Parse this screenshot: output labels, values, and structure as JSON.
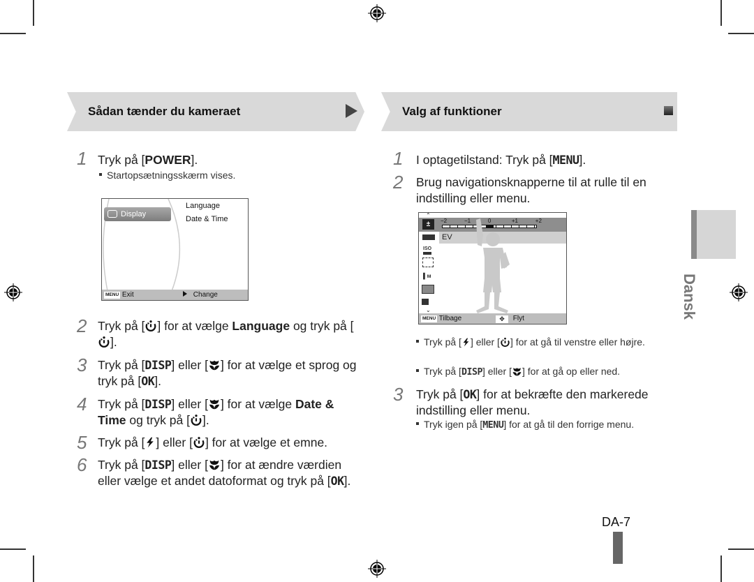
{
  "page": {
    "page_number": "DA-7",
    "language_tab": "Dansk"
  },
  "left_section": {
    "title": "Sådan tænder du kameraet",
    "steps": [
      {
        "num": "1",
        "parts": [
          "Tryk på [",
          "POWER",
          "]."
        ]
      },
      {
        "num": "2",
        "parts": [
          "Tryk på [",
          "timer-icon",
          "] for at vælge ",
          "Language",
          " og tryk på [",
          "timer-icon",
          "]."
        ]
      },
      {
        "num": "3",
        "parts": [
          "Tryk på [",
          "DISP",
          "] eller [",
          "macro-icon",
          "] for at vælge et sprog og tryk på [",
          "OK",
          "]."
        ]
      },
      {
        "num": "4",
        "parts": [
          "Tryk på [",
          "DISP",
          "] eller [",
          "macro-icon",
          "] for at vælge ",
          "Date & Time",
          " og tryk på [",
          "timer-icon",
          "]."
        ]
      },
      {
        "num": "5",
        "parts": [
          "Tryk på [",
          "flash-icon",
          "] eller [",
          "timer-icon",
          "] for at vælge et emne."
        ]
      },
      {
        "num": "6",
        "parts": [
          "Tryk på [",
          "DISP",
          "] eller [",
          "macro-icon",
          "] for at ændre værdien eller vælge et andet datoformat og tryk på [",
          "OK",
          "]."
        ]
      }
    ],
    "step1_sub": "Startopsætningsskærm vises.",
    "screen": {
      "menu_item": "Display",
      "options": [
        "Language",
        "Date & Time"
      ],
      "footer_left_key": "MENU",
      "footer_left": "Exit",
      "footer_right": "Change"
    }
  },
  "right_section": {
    "title": "Valg af funktioner",
    "step1": {
      "num": "1",
      "text": "I optagetilstand: Tryk på [",
      "key": "MENU",
      "end": "]."
    },
    "step2": {
      "num": "2",
      "text": "Brug navigationsknapperne til at rulle til en indstilling eller menu."
    },
    "bullets": [
      {
        "a": "Tryk på [",
        "b": "] eller [",
        "c": "] for at gå til venstre eller højre."
      },
      {
        "a": "Tryk på [",
        "key": "DISP",
        "b": "] eller [",
        "c": "] for at gå op eller ned."
      }
    ],
    "step3": {
      "num": "3",
      "a": "Tryk på [",
      "key": "OK",
      "b": "] for at bekræfte den markerede indstilling eller menu."
    },
    "step3_sub": {
      "a": "Tryk igen på [",
      "key": "MENU",
      "b": "] for at gå til den forrige menu."
    },
    "screen": {
      "ev_scale": [
        "−2",
        "−1",
        "0",
        "+1",
        "+2"
      ],
      "ev_value": 0,
      "selected_label": "EV",
      "footer_left_key": "MENU",
      "footer_left": "Tilbage",
      "footer_right": "Flyt"
    }
  }
}
